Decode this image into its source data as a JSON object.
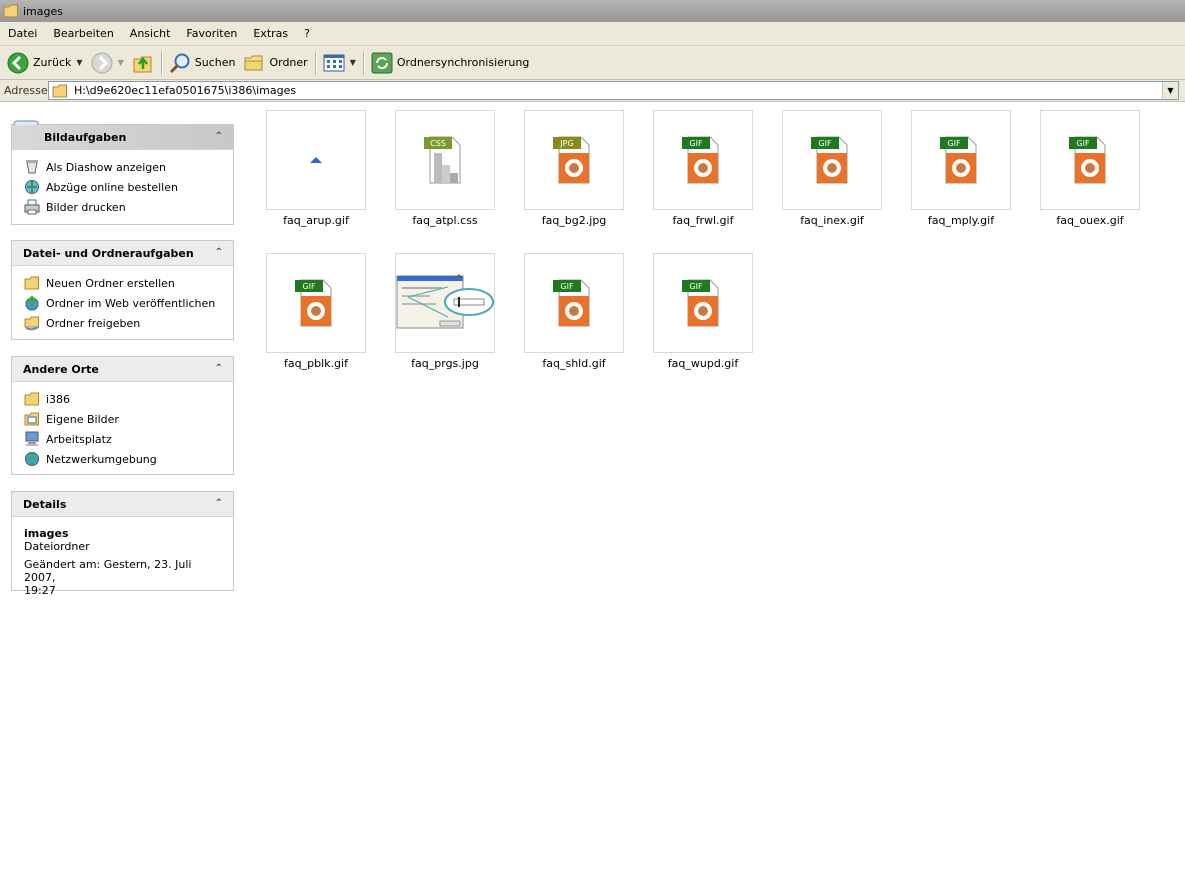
{
  "window": {
    "title": "images"
  },
  "menu": [
    "Datei",
    "Bearbeiten",
    "Ansicht",
    "Favoriten",
    "Extras",
    "?"
  ],
  "toolbar": {
    "back_label": "Zurück",
    "search_label": "Suchen",
    "folders_label": "Ordner",
    "sync_label": "Ordnersynchronisierung"
  },
  "address": {
    "label": "Adresse",
    "path": "H:\\d9e620ec11efa0501675\\i386\\images"
  },
  "panels": {
    "picture_tasks": {
      "title": "Bildaufgaben",
      "items": [
        "Als Diashow anzeigen",
        "Abzüge online bestellen",
        "Bilder drucken"
      ]
    },
    "file_tasks": {
      "title": "Datei- und Ordneraufgaben",
      "items": [
        "Neuen Ordner erstellen",
        "Ordner im Web veröffentlichen",
        "Ordner freigeben"
      ]
    },
    "other_places": {
      "title": "Andere Orte",
      "items": [
        "i386",
        "Eigene Bilder",
        "Arbeitsplatz",
        "Netzwerkumgebung"
      ]
    },
    "details": {
      "title": "Details",
      "name": "images",
      "type": "Dateiordner",
      "modified_line1": "Geändert am: Gestern, 23. Juli 2007,",
      "modified_line2": "19:27"
    }
  },
  "files": [
    {
      "name": "faq_arup.gif",
      "kind": "arrow"
    },
    {
      "name": "faq_atpl.css",
      "kind": "CSS"
    },
    {
      "name": "faq_bg2.jpg",
      "kind": "JPG"
    },
    {
      "name": "faq_frwl.gif",
      "kind": "GIF"
    },
    {
      "name": "faq_inex.gif",
      "kind": "GIF"
    },
    {
      "name": "faq_mply.gif",
      "kind": "GIF"
    },
    {
      "name": "faq_ouex.gif",
      "kind": "GIF"
    },
    {
      "name": "faq_pblk.gif",
      "kind": "GIF"
    },
    {
      "name": "faq_prgs.jpg",
      "kind": "screenshot"
    },
    {
      "name": "faq_shld.gif",
      "kind": "GIF"
    },
    {
      "name": "faq_wupd.gif",
      "kind": "GIF"
    }
  ],
  "colors": {
    "gif_label": "#1f7a1f",
    "jpg_label": "#8a8a1a",
    "css_label": "#7a9a2a",
    "orange": "#e8722a",
    "panel_head": "#ececec"
  }
}
